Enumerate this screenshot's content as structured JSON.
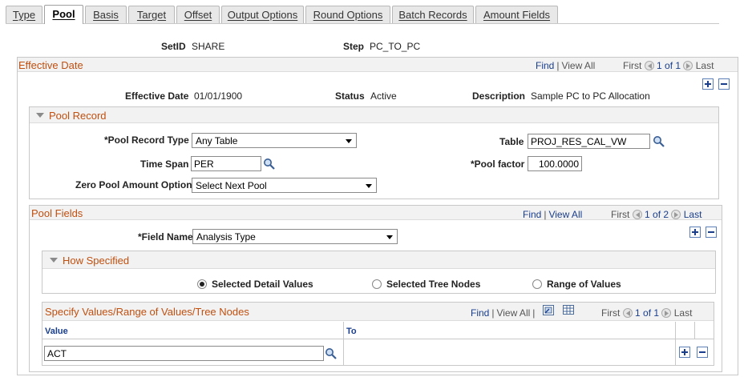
{
  "tabs": [
    "Type",
    "Pool",
    "Basis",
    "Target",
    "Offset",
    "Output Options",
    "Round Options",
    "Batch Records",
    "Amount Fields"
  ],
  "active_tab": "Pool",
  "header": {
    "setid_label": "SetID",
    "setid_value": "SHARE",
    "step_label": "Step",
    "step_value": "PC_TO_PC"
  },
  "effective_date_section": {
    "title": "Effective Date",
    "nav": {
      "find": "Find",
      "view_all": "View All",
      "first": "First",
      "range": "1 of 1",
      "last": "Last"
    },
    "eff_date_label": "Effective Date",
    "eff_date_value": "01/01/1900",
    "status_label": "Status",
    "status_value": "Active",
    "description_label": "Description",
    "description_value": "Sample PC to PC Allocation"
  },
  "pool_record": {
    "title": "Pool Record",
    "record_type_label": "*Pool Record Type",
    "record_type_value": "Any Table",
    "table_label": "Table",
    "table_value": "PROJ_RES_CAL_VW",
    "time_span_label": "Time Span",
    "time_span_value": "PER",
    "pool_factor_label": "*Pool factor",
    "pool_factor_value": "100.0000",
    "zero_pool_label": "Zero Pool Amount Option",
    "zero_pool_value": "Select Next Pool"
  },
  "pool_fields": {
    "title": "Pool Fields",
    "nav": {
      "find": "Find",
      "view_all": "View All",
      "first": "First",
      "range": "1 of 2",
      "last": "Last"
    },
    "field_name_label": "*Field Name",
    "field_name_value": "Analysis Type"
  },
  "how_specified": {
    "title": "How Specified",
    "options": [
      "Selected Detail Values",
      "Selected Tree Nodes",
      "Range of Values"
    ],
    "selected_index": 0
  },
  "values_grid": {
    "title": "Specify Values/Range of Values/Tree Nodes",
    "nav": {
      "find": "Find",
      "view_all": "View All",
      "first": "First",
      "range": "1 of 1",
      "last": "Last"
    },
    "columns": [
      "Value",
      "To"
    ],
    "rows": [
      {
        "value": "ACT",
        "to": ""
      }
    ]
  },
  "colors": {
    "section_title": "#c05010",
    "link": "#1a3e8c",
    "header_bg": "#f2f2f2",
    "border": "#c8c8c8"
  }
}
